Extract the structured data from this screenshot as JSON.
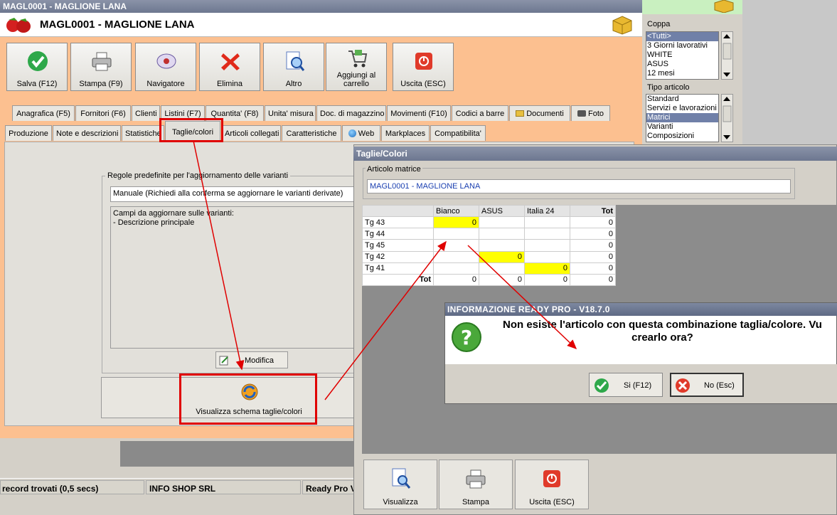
{
  "main_window": {
    "title": "MAGL0001 - MAGLIONE LANA",
    "close_glyph": "×",
    "article_title": "MAGL0001 - MAGLIONE LANA"
  },
  "toolbar": [
    {
      "label": "Salva (F12)",
      "icon": "check-icon"
    },
    {
      "label": "Stampa (F9)",
      "icon": "printer-icon"
    },
    {
      "label": "Navigatore",
      "icon": "navigator-icon"
    },
    {
      "label": "Elimina",
      "icon": "delete-x-icon"
    },
    {
      "label": "Altro",
      "icon": "search-doc-icon"
    },
    {
      "label": "Aggiungi al carrello",
      "icon": "cart-icon"
    },
    {
      "label": "Uscita (ESC)",
      "icon": "exit-icon"
    }
  ],
  "tabs_row1": [
    "Anagrafica (F5)",
    "Fornitori (F6)",
    "Clienti",
    "Listini (F7)",
    "Quantita' (F8)",
    "Unita' misura",
    "Doc. di magazzino",
    "Movimenti (F10)",
    "Codici a barre",
    "Documenti",
    "Foto"
  ],
  "tabs_row2": [
    "Produzione",
    "Note e descrizioni",
    "Statistiche",
    "Taglie/colori",
    "Articoli collegati",
    "Caratteristiche",
    "Web",
    "Markplaces",
    "Compatibilita'"
  ],
  "variants": {
    "group_label": "Regole predefinite per l'aggiornamento delle varianti",
    "combo_value": "Manuale (Richiedi alla conferma se aggiornare le varianti derivate)",
    "memo_text": "Campi da aggiornare sulle varianti:\n- Descrizione principale",
    "modifica_label": "Modifica",
    "show_scheme_label": "Visualizza schema taglie/colori"
  },
  "status_bar": {
    "records": "record trovati (0,5 secs)",
    "company": "INFO SHOP SRL",
    "app": "Ready Pro V"
  },
  "filters": {
    "coppa_label": "Coppa",
    "coppa_items": [
      "<Tutti>",
      "3 Giorni lavorativi",
      "WHITE",
      "ASUS",
      "12 mesi"
    ],
    "coppa_selected": 0,
    "tipo_label": "Tipo articolo",
    "tipo_items": [
      "Standard",
      "Servizi e lavorazioni",
      "Matrici",
      "Varianti",
      "Composizioni"
    ],
    "tipo_selected": 2
  },
  "tc_window": {
    "title": "Taglie/Colori",
    "matrix_label": "Articolo matrice",
    "matrix_value": "MAGL0001 - MAGLIONE LANA",
    "columns": [
      "",
      "Bianco",
      "ASUS",
      "Italia 24",
      "Tot"
    ],
    "rows": [
      {
        "label": "Tg 43",
        "cells": [
          "0",
          "",
          "",
          "0"
        ],
        "highlight": 0
      },
      {
        "label": "Tg 44",
        "cells": [
          "",
          "",
          "",
          "0"
        ],
        "highlight": -1
      },
      {
        "label": "Tg 45",
        "cells": [
          "",
          "",
          "",
          "0"
        ],
        "highlight": -1
      },
      {
        "label": "Tg 42",
        "cells": [
          "",
          "0",
          "",
          "0"
        ],
        "highlight": 1
      },
      {
        "label": "Tg 41",
        "cells": [
          "",
          "",
          "0",
          "0"
        ],
        "highlight": 2
      }
    ],
    "total_row": {
      "label": "Tot",
      "cells": [
        "0",
        "0",
        "0",
        "0"
      ]
    },
    "buttons": [
      "Visualizza",
      "Stampa",
      "Uscita (ESC)"
    ]
  },
  "dialog": {
    "title": "INFORMAZIONE READY PRO - V18.7.0",
    "message": "Non esiste l'articolo con questa combinazione taglia/colore. Vu\ncrearlo ora?",
    "yes_label": "Si (F12)",
    "no_label": "No (Esc)"
  },
  "colors": {
    "accent_orange": "#fcc090",
    "highlight_yellow": "#ffff00",
    "annotation_red": "#e00000"
  }
}
